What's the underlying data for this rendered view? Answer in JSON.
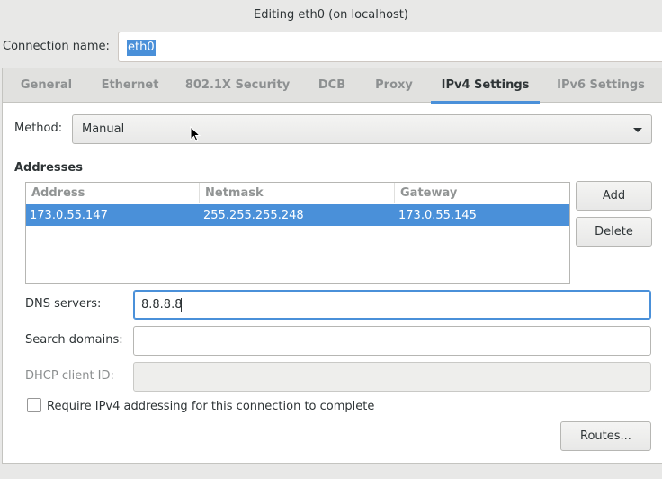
{
  "window": {
    "title": "Editing eth0 (on localhost)"
  },
  "connection": {
    "label": "Connection name:",
    "value": "eth0"
  },
  "tabs": [
    {
      "label": "General"
    },
    {
      "label": "Ethernet"
    },
    {
      "label": "802.1X Security"
    },
    {
      "label": "DCB"
    },
    {
      "label": "Proxy"
    },
    {
      "label": "IPv4 Settings",
      "active": true
    },
    {
      "label": "IPv6 Settings"
    }
  ],
  "ipv4": {
    "method_label": "Method:",
    "method_value": "Manual",
    "addresses_heading": "Addresses",
    "columns": [
      "Address",
      "Netmask",
      "Gateway"
    ],
    "rows": [
      {
        "address": "173.0.55.147",
        "netmask": "255.255.255.248",
        "gateway": "173.0.55.145"
      }
    ],
    "add_label": "Add",
    "delete_label": "Delete",
    "dns_label": "DNS servers:",
    "dns_value": "8.8.8.8",
    "search_label": "Search domains:",
    "search_value": "",
    "dhcp_label": "DHCP client ID:",
    "dhcp_value": "",
    "require_label": "Require IPv4 addressing for this connection to complete",
    "require_checked": false,
    "routes_label": "Routes..."
  },
  "colors": {
    "accent": "#4a90d9",
    "background": "#e8e8e7"
  }
}
